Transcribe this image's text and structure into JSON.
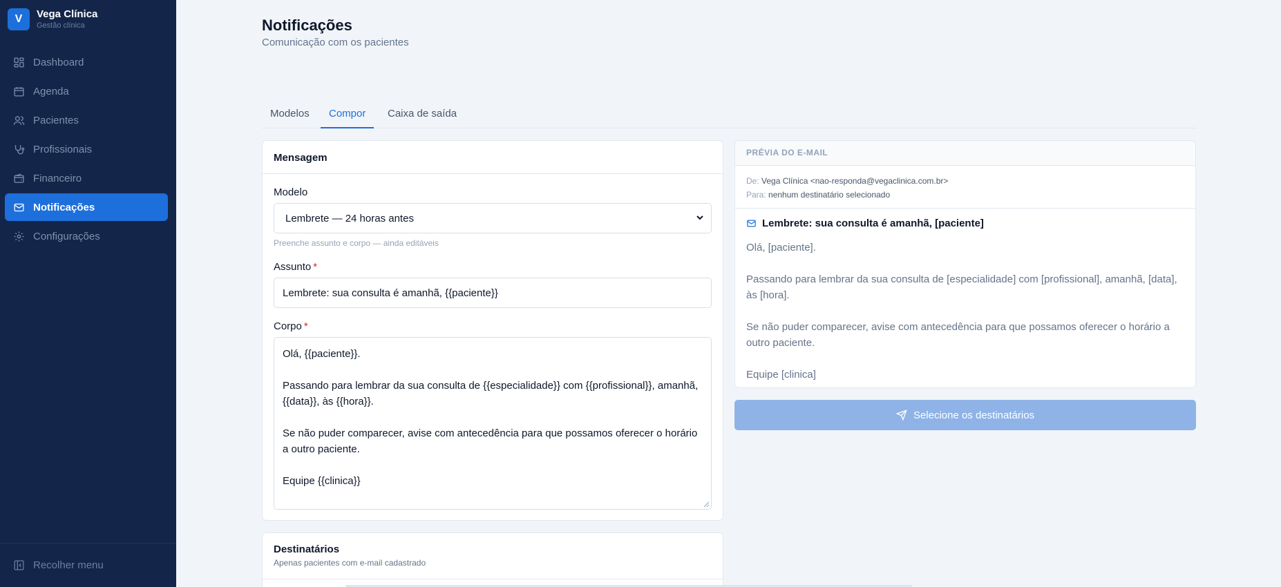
{
  "brand": {
    "initial": "V",
    "name": "Vega Clínica",
    "subtitle": "Gestão clínica"
  },
  "sidebar": {
    "items": [
      {
        "label": "Dashboard",
        "icon": "grid-icon",
        "active": false
      },
      {
        "label": "Agenda",
        "icon": "calendar-icon",
        "active": false
      },
      {
        "label": "Pacientes",
        "icon": "users-icon",
        "active": false
      },
      {
        "label": "Profissionais",
        "icon": "stethoscope-icon",
        "active": false
      },
      {
        "label": "Financeiro",
        "icon": "wallet-icon",
        "active": false
      },
      {
        "label": "Notificações",
        "icon": "mail-icon",
        "active": true
      },
      {
        "label": "Configurações",
        "icon": "gear-icon",
        "active": false
      }
    ],
    "collapse_label": "Recolher menu"
  },
  "page": {
    "title": "Notificações",
    "subtitle": "Comunicação com os pacientes"
  },
  "tabs": [
    {
      "label": "Modelos",
      "active": false
    },
    {
      "label": "Compor",
      "active": true
    },
    {
      "label": "Caixa de saída",
      "active": false
    }
  ],
  "message": {
    "title": "Mensagem",
    "template_label": "Modelo",
    "template_value": "Lembrete — 24 horas antes",
    "template_hint": "Preenche assunto e corpo — ainda editáveis",
    "subject_label": "Assunto",
    "required_mark": "*",
    "subject_value": "Lembrete: sua consulta é amanhã, {{paciente}}",
    "body_label": "Corpo",
    "body_value": "Olá, {{paciente}}.\n\nPassando para lembrar da sua consulta de {{especialidade}} com {{profissional}}, amanhã, {{data}}, às {{hora}}.\n\nSe não puder comparecer, avise com antecedência para que possamos oferecer o horário a outro paciente.\n\nEquipe {{clinica}}"
  },
  "recipients": {
    "title": "Destinatários",
    "subtitle": "Apenas pacientes com e-mail cadastrado"
  },
  "preview": {
    "header": "PRÉVIA DO E-MAIL",
    "from_key": "De:",
    "from_value": "Vega Clínica <nao-responda@vegaclinica.com.br>",
    "to_key": "Para:",
    "to_value": "nenhum destinatário selecionado",
    "subject": "Lembrete: sua consulta é amanhã, [paciente]",
    "body": "Olá, [paciente].\n\nPassando para lembrar da sua consulta de [especialidade] com [profissional], amanhã, [data], às [hora].\n\nSe não puder comparecer, avise com antecedência para que possamos oferecer o horário a outro paciente.\n\nEquipe [clinica]"
  },
  "send_button": {
    "label": "Selecione os destinatários",
    "enabled": false
  },
  "colors": {
    "sidebar_bg": "#13264a",
    "accent": "#1d6fdc",
    "required": "#dc2626",
    "disabled_button": "#8fb3e6"
  }
}
